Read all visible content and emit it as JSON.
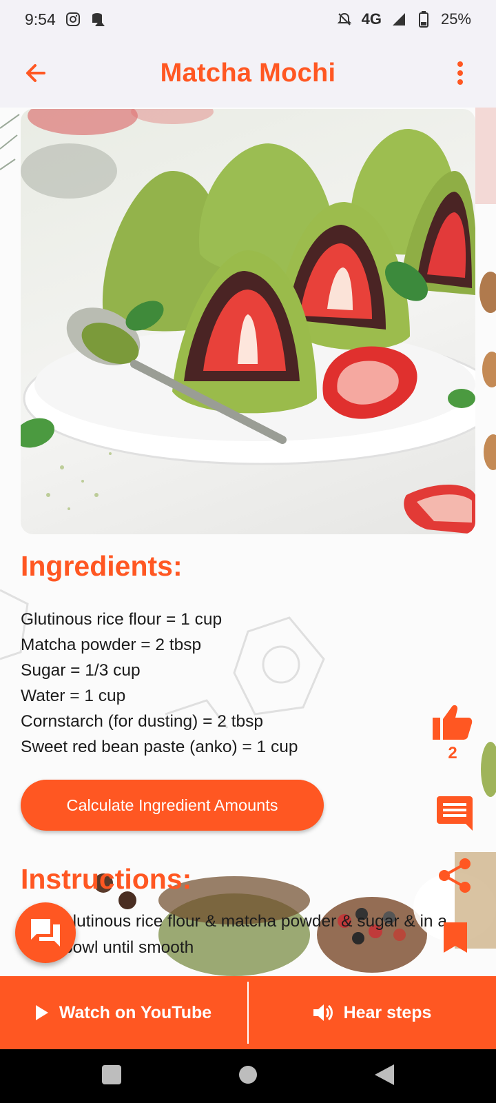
{
  "status_bar": {
    "time": "9:54",
    "network": "4G",
    "battery": "25%",
    "icons": [
      "instagram-icon",
      "data-saver-icon",
      "notifications-off-icon",
      "signal-icon",
      "battery-icon"
    ]
  },
  "app_bar": {
    "title": "Matcha Mochi",
    "back_icon": "arrow-back-icon",
    "more_icon": "more-vertical-icon"
  },
  "hero_image": {
    "alt": "Matcha mochi with strawberries on a plate"
  },
  "ingredients": {
    "title": "Ingredients:",
    "items": [
      "Glutinous rice flour = 1 cup",
      "Matcha powder = 2 tbsp",
      "Sugar = 1/3 cup",
      "Water = 1 cup",
      "Cornstarch (for dusting) = 2 tbsp",
      "Sweet red bean paste (anko) = 1 cup"
    ],
    "calculate_button": "Calculate Ingredient Amounts"
  },
  "instructions": {
    "title": "Instructions:",
    "step_1": "glutinous rice flour & matcha powder & sugar & in a bowl until smooth"
  },
  "side_actions": {
    "like_count": "2",
    "icons": [
      "thumb-up-icon",
      "comment-icon",
      "share-icon",
      "bookmark-icon"
    ]
  },
  "bottom_bar": {
    "youtube_label": "Watch on YouTube",
    "hear_label": "Hear steps"
  },
  "colors": {
    "accent": "#ff5722",
    "app_bar_bg": "#f3f2f7",
    "text": "#1c1c1c"
  }
}
